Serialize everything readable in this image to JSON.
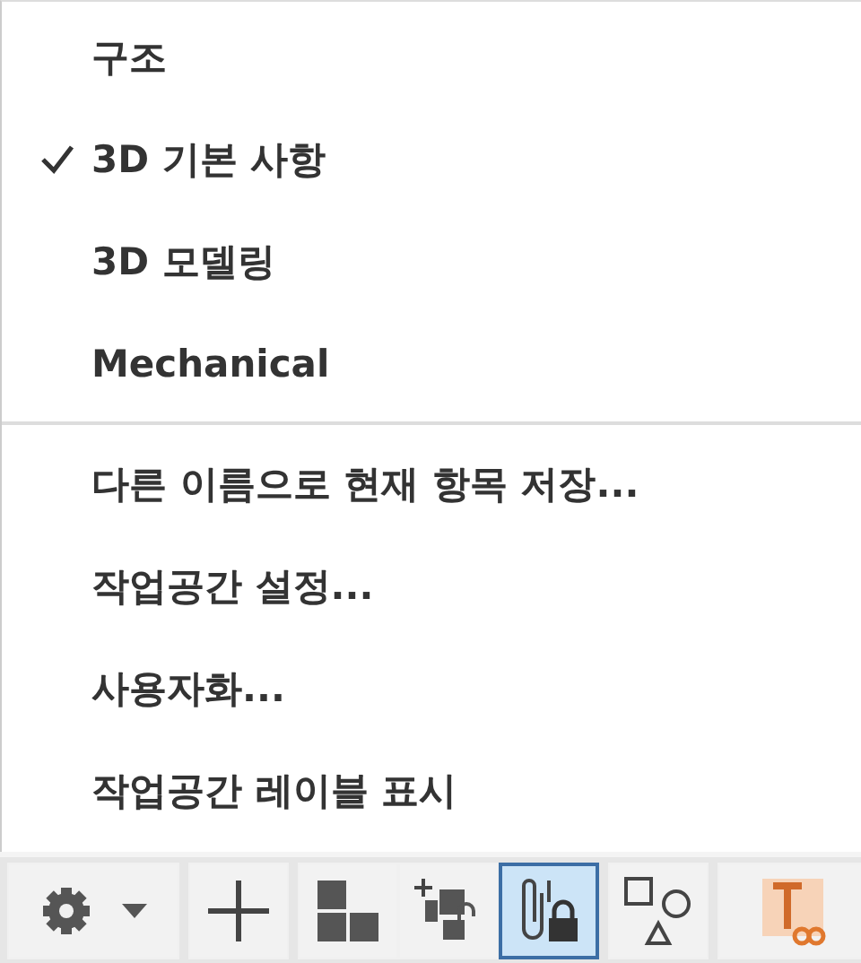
{
  "menu": {
    "workspaces": [
      {
        "label": "구조",
        "checked": false
      },
      {
        "label": "3D 기본 사항",
        "checked": true
      },
      {
        "label": "3D 모델링",
        "checked": false
      },
      {
        "label": "Mechanical",
        "checked": false
      }
    ],
    "actions": [
      {
        "label": "다른 이름으로 현재 항목 저장..."
      },
      {
        "label": "작업공간 설정..."
      },
      {
        "label": "사용자화..."
      },
      {
        "label": "작업공간 레이블 표시"
      }
    ]
  },
  "toolbar": [
    {
      "kind": "settings",
      "selected": false
    },
    {
      "kind": "add",
      "selected": false
    },
    {
      "kind": "tiles",
      "selected": false
    },
    {
      "kind": "add-unlock",
      "selected": false
    },
    {
      "kind": "clip-lock",
      "selected": true
    },
    {
      "kind": "shapes",
      "selected": false
    },
    {
      "kind": "link-app",
      "selected": false
    }
  ]
}
